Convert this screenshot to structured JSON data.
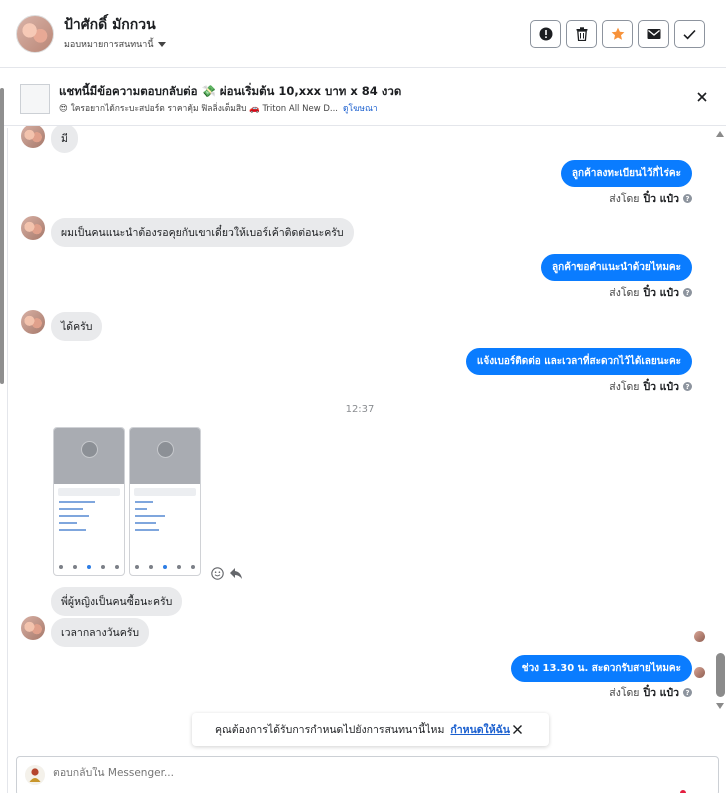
{
  "header": {
    "contact_name": "ป้าศักดิ์ มักกวน",
    "assign_label": "มอบหมายการสนทนานี้",
    "buttons": [
      "spam-icon",
      "trash-icon",
      "star-icon",
      "mail-icon",
      "check-icon"
    ],
    "star_color": "#f7923a"
  },
  "ad": {
    "title": "แชทนี้มีข้อความตอบกลับต่อ 💸 ผ่อนเริ่มต้น 10,xxx บาท x 84 งวด",
    "subtitle": "😍 ใครอยากได้กระบะสปอร์ต ราคาคุ้ม ฟิลลิ่งเต็มสิบ 🚗 Triton All New D...",
    "link": "ดูโฆษณา"
  },
  "messages": {
    "m1": "มี",
    "m2": "ลูกค้าลงทะเบียนไว้กี่ไร่คะ",
    "m3": "ผมเป็นคนแนะนำต้องรอคุยกับเขาเดี๋ยวให้เบอร์เค้าติดต่อนะครับ",
    "m4": "ลูกค้าขอคำแนะนำด้วยไหมคะ",
    "m5": "ได้ครับ",
    "m6": "แจ้งเบอร์ติดต่อ  และเวลาที่สะดวกไว้ได้เลยนะคะ",
    "timestamp": "12:37",
    "m7": "พี่ผู้หญิงเป็นคนซื้อนะครับ",
    "m8": "เวลากลางวันครับ",
    "m9": "ช่วง 13.30  น. สะดวกรับสายไหมคะ",
    "sent_by_prefix": "ส่งโดย",
    "sent_by_name": "ปิ๋ว แป๋ว",
    "outgoing_color": "#0a7cff"
  },
  "notice": {
    "text": "คุณต้องการได้รับการกำหนดไปยังการสนทนานี้ไหม",
    "link": "กำหนดให้ฉัน"
  },
  "composer": {
    "placeholder": "ตอบกลับใน Messenger..."
  }
}
